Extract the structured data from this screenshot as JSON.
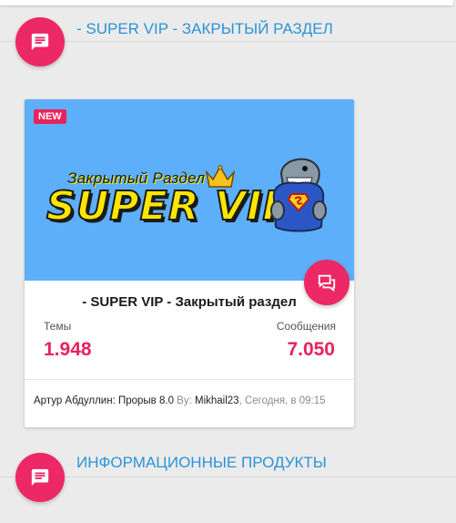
{
  "categories": [
    {
      "title": "- SUPER VIP - ЗАКРЫТЫЙ РАЗДЕЛ"
    },
    {
      "title": "ИНФОРМАЦИОННЫЕ ПРОДУКТЫ"
    }
  ],
  "forum": {
    "badge": "NEW",
    "banner_subtitle": "Закрытый Раздел",
    "banner_title": "SUPER VIP",
    "title": "- SUPER VIP - Закрытый раздел",
    "stats": {
      "topics_label": "Темы",
      "topics_value": "1.948",
      "posts_label": "Сообщения",
      "posts_value": "7.050"
    },
    "last_post": {
      "thread": "Артур Абдуллин: Прорыв 8.0",
      "by_label": "By:",
      "author": "Mikhail23",
      "time": ", Сегодня, в 09:15"
    }
  },
  "colors": {
    "accent": "#ec2866",
    "link": "#2b93d6",
    "banner_bg": "#5eaff9",
    "banner_text": "#ffe600"
  },
  "icons": [
    "forum-chat-icon",
    "chat-bubbles-icon",
    "crown-icon",
    "shark-mascot-icon"
  ]
}
